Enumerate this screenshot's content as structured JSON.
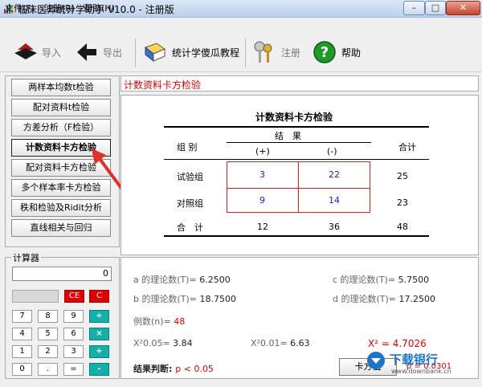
{
  "window": {
    "title": "临床医师统计学助手 V10.0 - 注册版"
  },
  "menu": [
    "文件(F)",
    "注册(R)",
    "帮助(H)"
  ],
  "toolbar": {
    "import": "导入",
    "export": "导出",
    "tutorial": "统计学傻瓜教程",
    "register": "注册",
    "help": "帮助"
  },
  "nav": {
    "items": [
      "两样本均数t检验",
      "配对资料t检验",
      "方差分析（F检验）",
      "计数资料卡方检验",
      "配对资料卡方检验",
      "多个样本率卡方检验",
      "秩和检验及Ridit分析",
      "直线相关与回归"
    ],
    "active_index": 3
  },
  "calculator": {
    "title": "计算器",
    "display": "0",
    "keys": {
      "ce": "CE",
      "c": "C",
      "k7": "7",
      "k8": "8",
      "k9": "9",
      "div": "÷",
      "k4": "4",
      "k5": "5",
      "k6": "6",
      "mul": "×",
      "k1": "1",
      "k2": "2",
      "k3": "3",
      "add": "+",
      "k0": "0",
      "dot": ".",
      "eq": "=",
      "sub": "-"
    }
  },
  "section_title": "计数资料卡方检验",
  "table": {
    "title": "计数资料卡方检验",
    "group_header": "组 别",
    "result_header": "结　果",
    "pos_header": "(+)",
    "neg_header": "(-)",
    "total_header": "合计",
    "rows": [
      {
        "label": "试验组",
        "pos": "3",
        "neg": "22",
        "total": "25"
      },
      {
        "label": "对照组",
        "pos": "9",
        "neg": "14",
        "total": "23"
      }
    ],
    "sum_row": {
      "label": "合　计",
      "pos": "12",
      "neg": "36",
      "total": "48"
    }
  },
  "results": {
    "a_label": "a 的理论数(T)=",
    "a_value": "6.2500",
    "b_label": "b 的理论数(T)=",
    "b_value": "18.7500",
    "c_label": "c 的理论数(T)=",
    "c_value": "5.7500",
    "d_label": "d 的理论数(T)=",
    "d_value": "17.2500",
    "n_label": "例数(n)=",
    "n_value": "48",
    "x05_label": "X²0.05=",
    "x05_value": "3.84",
    "x01_label": "X²0.01=",
    "x01_value": "6.63",
    "chi_label": "X² =",
    "chi_value": "4.7026",
    "conclusion_label": "结果判断:",
    "conclusion_value": "p < 0.05",
    "p_text": "p = 0.0301",
    "button": "卡方值"
  },
  "watermark": {
    "name": "下载银行",
    "url": "www.downbank.cn"
  },
  "colors": {
    "accent_red": "#e00000",
    "value_blue": "#2020c0",
    "calc_teal": "#14b0a8"
  }
}
